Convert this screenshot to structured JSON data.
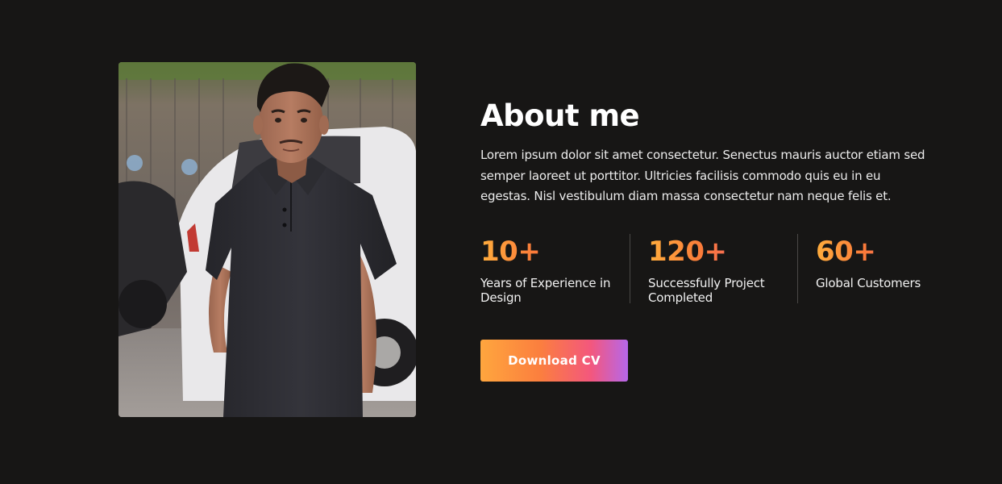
{
  "about": {
    "title": "About me",
    "description": "Lorem ipsum dolor sit amet consectetur. Senectus mauris auctor etiam sed semper laoreet ut porttitor. Ultricies facilisis commodo quis eu in eu egestas. Nisl vestibulum diam massa consectetur nam neque felis et.",
    "stats": [
      {
        "value": "10+",
        "label": "Years of Experience in Design"
      },
      {
        "value": "120+",
        "label": "Successfully Project Completed"
      },
      {
        "value": "60+",
        "label": "Global Customers"
      }
    ],
    "button_label": "Download CV"
  },
  "colors": {
    "background": "#171615",
    "accent_start": "#ffa63e",
    "accent_mid": "#f3577e",
    "accent_end": "#b667ea"
  }
}
